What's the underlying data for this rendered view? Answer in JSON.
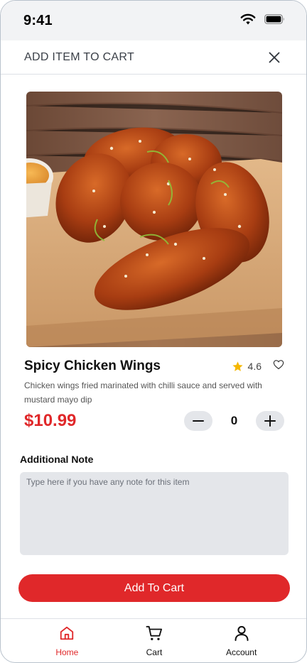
{
  "status_bar": {
    "time": "9:41"
  },
  "sheet": {
    "title": "ADD ITEM TO CART"
  },
  "product": {
    "name": "Spicy Chicken Wings",
    "rating": "4.6",
    "description": "Chicken wings fried marinated with chilli sauce and served with mustard mayo dip",
    "price": "$10.99",
    "quantity": "0"
  },
  "note": {
    "label": "Additional Note",
    "placeholder": "Type here if you have any note for this item",
    "value": ""
  },
  "cta": {
    "label": "Add To Cart"
  },
  "nav": {
    "items": [
      {
        "label": "Home",
        "icon": "home-icon",
        "active": true
      },
      {
        "label": "Cart",
        "icon": "cart-icon",
        "active": false
      },
      {
        "label": "Account",
        "icon": "account-icon",
        "active": false
      }
    ]
  },
  "colors": {
    "accent": "#e0282a",
    "star": "#f5b700",
    "field_bg": "#e4e6ea"
  }
}
